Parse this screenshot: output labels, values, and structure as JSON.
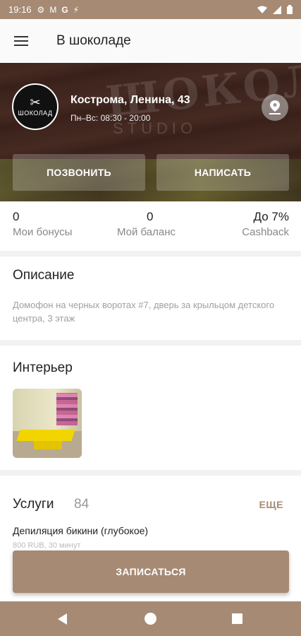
{
  "status_bar": {
    "time": "19:16",
    "icons": [
      "gear-icon",
      "gmail-icon",
      "google-icon",
      "usb-icon",
      "wifi-icon",
      "signal-icon",
      "battery-icon"
    ]
  },
  "app_bar": {
    "title": "В шоколаде",
    "menu_icon": "hamburger-icon"
  },
  "hero": {
    "logo_text": "ШОКОЛАД",
    "address": "Кострома, Ленина, 43",
    "hours": "Пн–Вс: 08:30 - 20:00",
    "call_label": "ПОЗВОНИТЬ",
    "write_label": "НАПИСАТЬ"
  },
  "stats": [
    {
      "value": "0",
      "label": "Мои бонусы"
    },
    {
      "value": "0",
      "label": "Мой баланс"
    },
    {
      "value": "До 7%",
      "label": "Cashback"
    }
  ],
  "description": {
    "title": "Описание",
    "text": "Домофон на черных воротах #7, дверь за крыльцом детского центра, 3 этаж"
  },
  "interior": {
    "title": "Интерьер"
  },
  "services": {
    "title": "Услуги",
    "count": "84",
    "more_label": "ЕЩЕ",
    "items": [
      {
        "name": "Депиляция бикини (глубокое)",
        "meta": "800 RUB, 30 минут"
      }
    ]
  },
  "book_button": {
    "label": "ЗАПИСАТЬСЯ"
  },
  "colors": {
    "accent": "#a68a74",
    "background": "#f2f2f2"
  }
}
